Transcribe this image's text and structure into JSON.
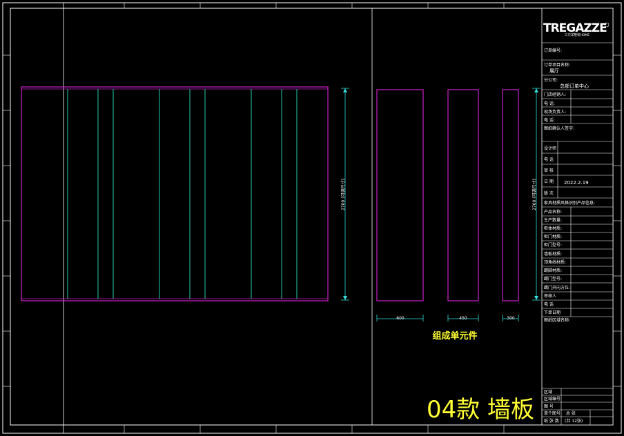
{
  "logo": {
    "brand": "TREGAZZE",
    "sub": "三只羊整装HOME",
    "reg": "®"
  },
  "dimensions": {
    "wall_height": "2700 (可调尺寸)",
    "unit_height": "2700 (可调尺寸)",
    "unit_widths": [
      "600",
      "450",
      "300"
    ]
  },
  "caption": "组成单元件",
  "title": "04款 墙板",
  "title_block": {
    "order_no_label": "订单编号:",
    "project_label": "订单项目名称:",
    "project_value": "展厅",
    "branch_label": "分公司:",
    "branch_value": "总部订单中心",
    "store_label": "门店经销人:",
    "phone1_label": "电 话:",
    "site_label": "现场负责人:",
    "phone2_label": "电 话:",
    "confirm_label": "图纸确认人签字:",
    "designer_label": "设计师",
    "phone3_label": "电 话",
    "review_label": "审 核",
    "date_label": "日 期",
    "date_value": "2022.2.19",
    "version_label": "版 次",
    "material_header": "家具材质风格识别产品信息:",
    "rows": [
      "产品名称:",
      "生产数量:",
      "柜体材质:",
      "柜门材质:",
      "柜门型号:",
      "墙板材质:",
      "顶角线材质:",
      "踢脚材质:",
      "踢门型号:",
      "踢门开向方位:",
      "审核人",
      "电 话",
      "下单日期"
    ],
    "drawing_name_label": "图纸区域名称:",
    "bottom_rows": [
      "区域",
      "区域编号",
      "图 号",
      "单个图号",
      "纸 张 数"
    ],
    "sheet_total": "总 张",
    "sheet_count": "(共 12张)"
  },
  "colors": {
    "panel_frame": "#cc22cc",
    "panel_lines": "#22ccaa",
    "dimension": "#33dddd",
    "title": "#ffff33",
    "border": "#ffffff"
  }
}
